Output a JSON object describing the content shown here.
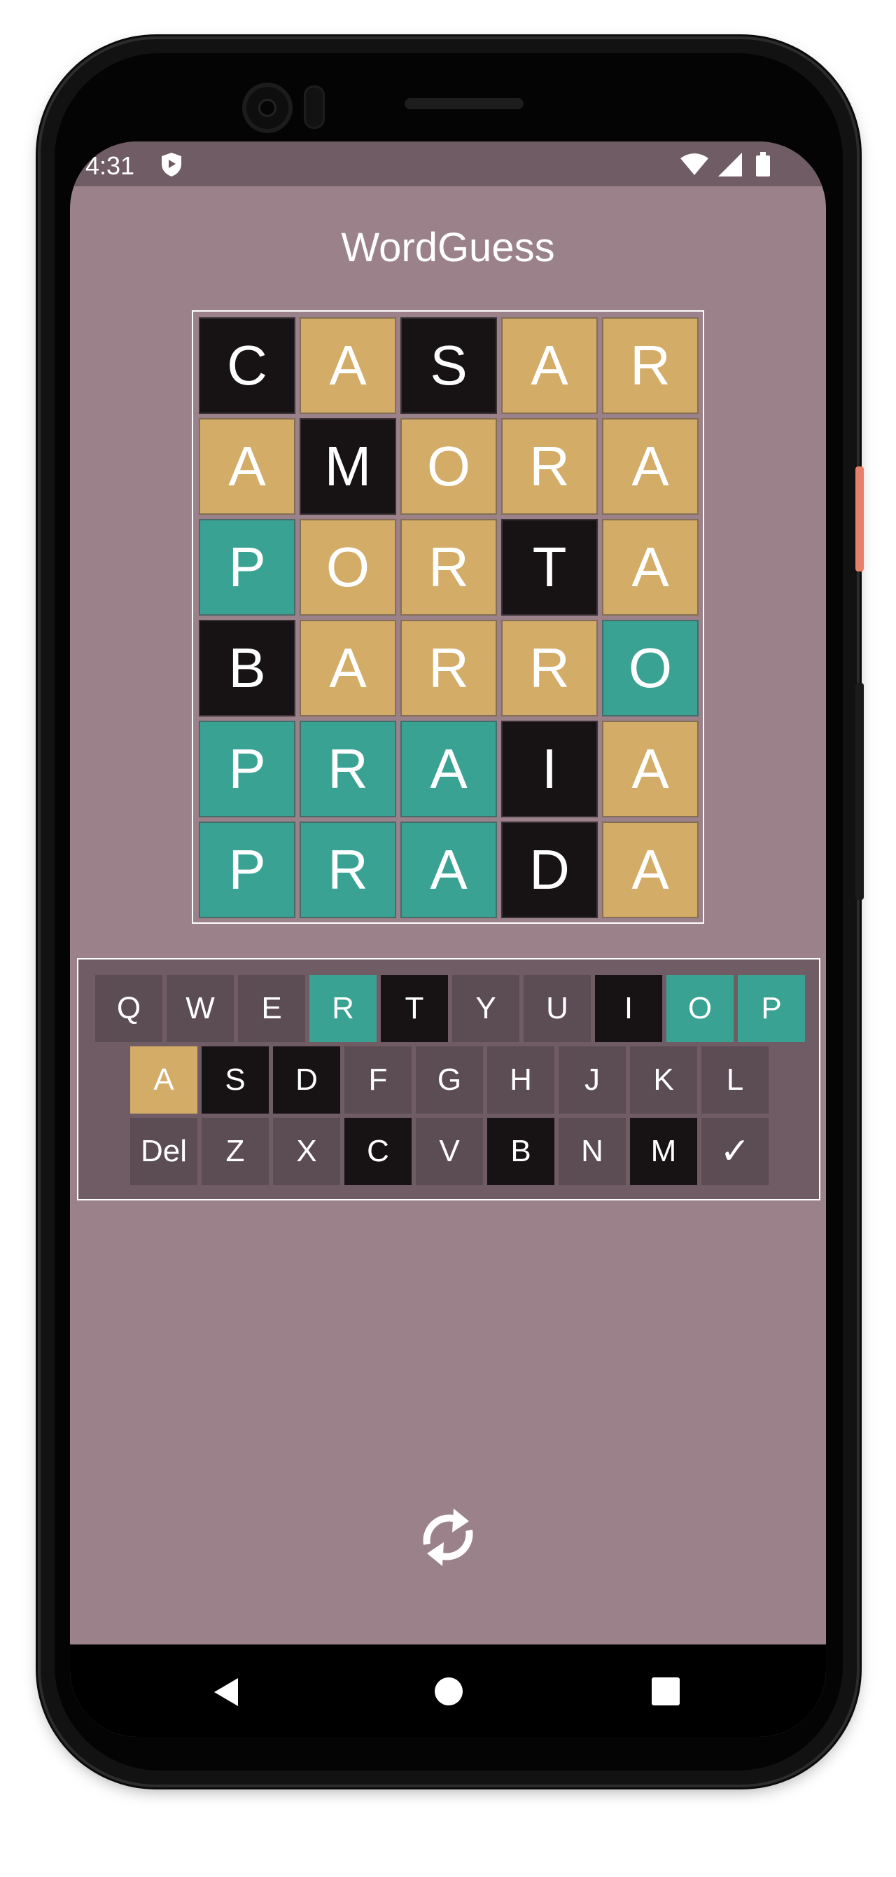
{
  "status": {
    "time": "4:31"
  },
  "app": {
    "title": "WordGuess"
  },
  "colors": {
    "correct": "#3aa293",
    "present": "#d3ac67",
    "absent": "#171314",
    "key_default": "#5c4c53",
    "background": "#9a818a",
    "statusbar": "#705c64"
  },
  "board": [
    [
      {
        "l": "C",
        "s": "absent"
      },
      {
        "l": "A",
        "s": "present"
      },
      {
        "l": "S",
        "s": "absent"
      },
      {
        "l": "A",
        "s": "present"
      },
      {
        "l": "R",
        "s": "present"
      }
    ],
    [
      {
        "l": "A",
        "s": "present"
      },
      {
        "l": "M",
        "s": "absent"
      },
      {
        "l": "O",
        "s": "present"
      },
      {
        "l": "R",
        "s": "present"
      },
      {
        "l": "A",
        "s": "present"
      }
    ],
    [
      {
        "l": "P",
        "s": "correct"
      },
      {
        "l": "O",
        "s": "present"
      },
      {
        "l": "R",
        "s": "present"
      },
      {
        "l": "T",
        "s": "absent"
      },
      {
        "l": "A",
        "s": "present"
      }
    ],
    [
      {
        "l": "B",
        "s": "absent"
      },
      {
        "l": "A",
        "s": "present"
      },
      {
        "l": "R",
        "s": "present"
      },
      {
        "l": "R",
        "s": "present"
      },
      {
        "l": "O",
        "s": "correct"
      }
    ],
    [
      {
        "l": "P",
        "s": "correct"
      },
      {
        "l": "R",
        "s": "correct"
      },
      {
        "l": "A",
        "s": "correct"
      },
      {
        "l": "I",
        "s": "absent"
      },
      {
        "l": "A",
        "s": "present"
      }
    ],
    [
      {
        "l": "P",
        "s": "correct"
      },
      {
        "l": "R",
        "s": "correct"
      },
      {
        "l": "A",
        "s": "correct"
      },
      {
        "l": "D",
        "s": "absent"
      },
      {
        "l": "A",
        "s": "present"
      }
    ]
  ],
  "keyboard": {
    "rows": [
      [
        {
          "k": "Q",
          "s": "default"
        },
        {
          "k": "W",
          "s": "default"
        },
        {
          "k": "E",
          "s": "default"
        },
        {
          "k": "R",
          "s": "correct"
        },
        {
          "k": "T",
          "s": "absent"
        },
        {
          "k": "Y",
          "s": "default"
        },
        {
          "k": "U",
          "s": "default"
        },
        {
          "k": "I",
          "s": "absent"
        },
        {
          "k": "O",
          "s": "correct"
        },
        {
          "k": "P",
          "s": "correct"
        }
      ],
      [
        {
          "k": "A",
          "s": "present"
        },
        {
          "k": "S",
          "s": "absent"
        },
        {
          "k": "D",
          "s": "absent"
        },
        {
          "k": "F",
          "s": "default"
        },
        {
          "k": "G",
          "s": "default"
        },
        {
          "k": "H",
          "s": "default"
        },
        {
          "k": "J",
          "s": "default"
        },
        {
          "k": "K",
          "s": "default"
        },
        {
          "k": "L",
          "s": "default"
        }
      ],
      [
        {
          "k": "Del",
          "s": "default"
        },
        {
          "k": "Z",
          "s": "default"
        },
        {
          "k": "X",
          "s": "default"
        },
        {
          "k": "C",
          "s": "absent"
        },
        {
          "k": "V",
          "s": "default"
        },
        {
          "k": "B",
          "s": "absent"
        },
        {
          "k": "N",
          "s": "default"
        },
        {
          "k": "M",
          "s": "absent"
        },
        {
          "k": "✓",
          "s": "default"
        }
      ]
    ]
  }
}
